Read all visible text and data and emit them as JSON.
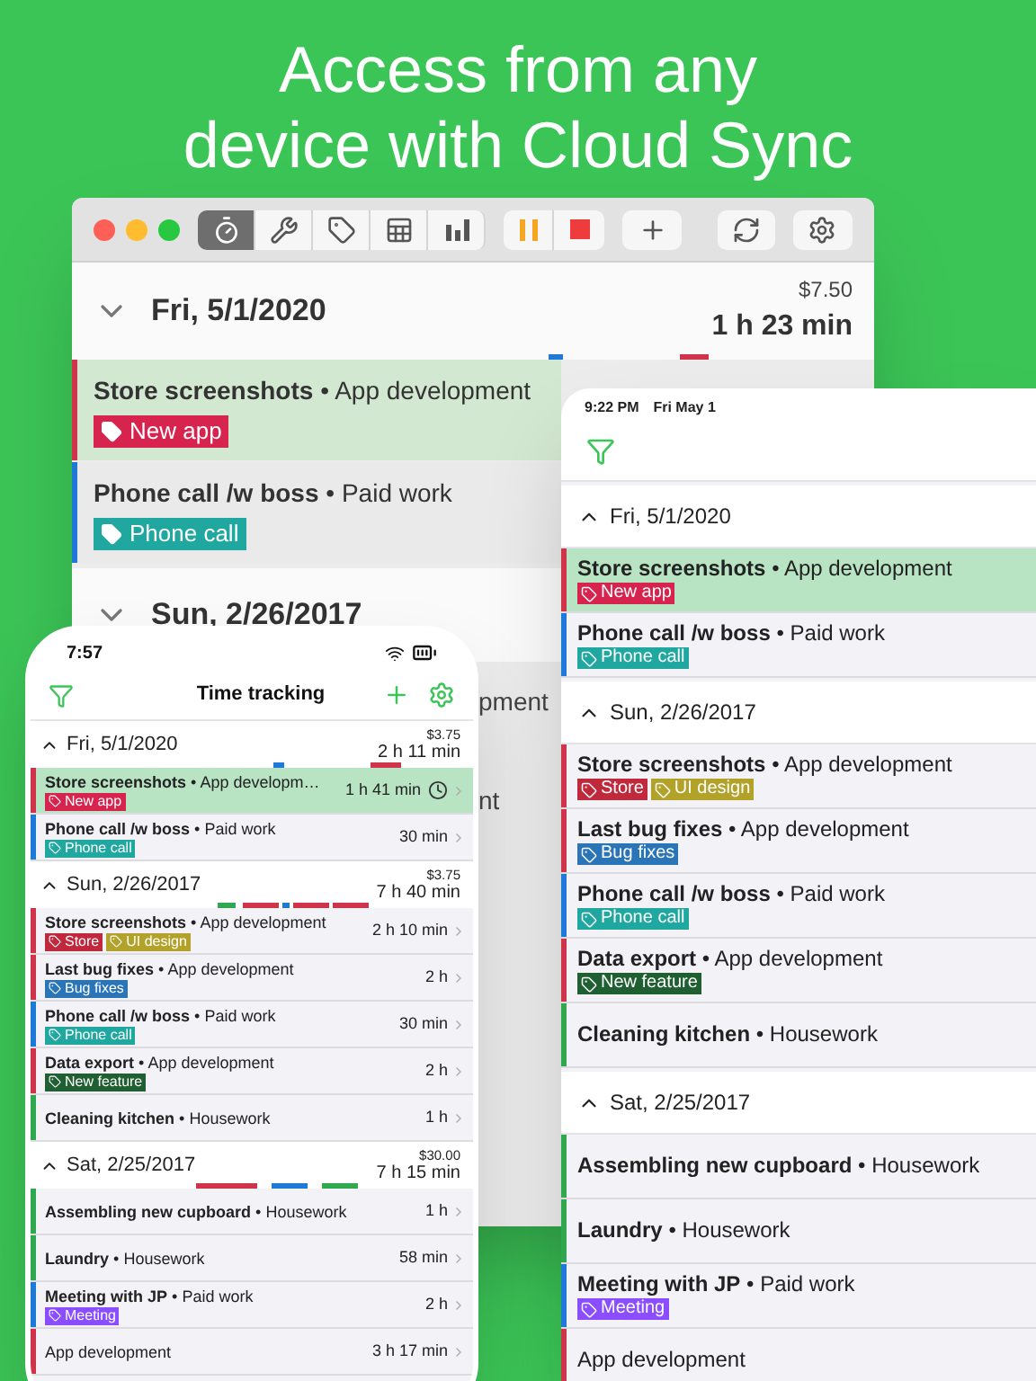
{
  "headline": "Access from any device with Cloud Sync",
  "mac_window": {
    "tools": [
      {
        "selected": true
      },
      {
        "selected": false
      },
      {
        "selected": false
      },
      {
        "selected": false
      },
      {
        "selected": false
      }
    ],
    "days": [
      {
        "date": "Fri, 5/1/2020",
        "amount": "$7.50",
        "total": "1 h 23 min",
        "entries": [
          {
            "title": "Store screenshots",
            "separator": "•",
            "category": "App development",
            "color": "#d0344a",
            "selected": true,
            "tags": [
              {
                "label": "New app",
                "color": "#d6244f"
              }
            ]
          },
          {
            "title": "Phone call /w boss",
            "separator": "•",
            "category": "Paid work",
            "color": "#1e7ad6",
            "selected": false,
            "tags": [
              {
                "label": "Phone call",
                "color": "#20a8a0"
              }
            ]
          }
        ]
      },
      {
        "date": "Sun, 2/26/2017",
        "fragments": [
          "pment",
          "nt"
        ]
      }
    ]
  },
  "ipad": {
    "status": "9:22 PM",
    "status_date": "Fri May 1",
    "days": [
      {
        "date": "Fri, 5/1/2020",
        "entries": [
          {
            "title": "Store screenshots",
            "separator": "•",
            "category": "App development",
            "color": "#d0344a",
            "selected": true,
            "tags": [
              {
                "label": "New app",
                "color": "#d6244f"
              }
            ]
          },
          {
            "title": "Phone call /w boss",
            "separator": "•",
            "category": "Paid work",
            "color": "#1e7ad6",
            "selected": false,
            "tags": [
              {
                "label": "Phone call",
                "color": "#20a8a0"
              }
            ]
          }
        ]
      },
      {
        "date": "Sun, 2/26/2017",
        "entries": [
          {
            "title": "Store screenshots",
            "separator": "•",
            "category": "App development",
            "color": "#d0344a",
            "selected": false,
            "tags": [
              {
                "label": "Store",
                "color": "#c0283c"
              },
              {
                "label": "UI design",
                "color": "#b3a22a"
              }
            ]
          },
          {
            "title": "Last bug fixes",
            "separator": "•",
            "category": "App development",
            "color": "#d0344a",
            "selected": false,
            "tags": [
              {
                "label": "Bug fixes",
                "color": "#2a74b8"
              }
            ]
          },
          {
            "title": "Phone call /w boss",
            "separator": "•",
            "category": "Paid work",
            "color": "#1e7ad6",
            "selected": false,
            "tags": [
              {
                "label": "Phone call",
                "color": "#20a8a0"
              }
            ]
          },
          {
            "title": "Data export",
            "separator": "•",
            "category": "App development",
            "color": "#d0344a",
            "selected": false,
            "tags": [
              {
                "label": "New feature",
                "color": "#1f5f32"
              }
            ]
          },
          {
            "title": "Cleaning kitchen",
            "separator": "•",
            "category": "Housework",
            "color": "#2fa84f",
            "selected": false
          }
        ]
      },
      {
        "date": "Sat, 2/25/2017",
        "entries": [
          {
            "title": "Assembling new cupboard",
            "separator": "•",
            "category": "Housework",
            "color": "#2fa84f",
            "selected": false
          },
          {
            "title": "Laundry",
            "separator": "•",
            "category": "Housework",
            "color": "#2fa84f",
            "selected": false
          },
          {
            "title": "Meeting with JP",
            "separator": "•",
            "category": "Paid work",
            "color": "#1e7ad6",
            "selected": false,
            "tags": [
              {
                "label": "Meeting",
                "color": "#8a4dff"
              }
            ]
          },
          {
            "category": "App development",
            "color": "#d0344a",
            "selected": false
          }
        ]
      }
    ]
  },
  "iphone": {
    "time": "7:57",
    "title": "Time tracking",
    "days": [
      {
        "date": "Fri, 5/1/2020",
        "amount": "$3.75",
        "total": "2 h 11 min",
        "entries": [
          {
            "title": "Store screenshots",
            "separator": "•",
            "category": "App developm…",
            "duration": "1 h 41 min",
            "running": true,
            "color": "#d0344a",
            "selected": true,
            "tags": [
              {
                "label": "New app",
                "color": "#d6244f"
              }
            ]
          },
          {
            "title": "Phone call /w boss",
            "separator": "•",
            "category": "Paid work",
            "duration": "30 min",
            "running": false,
            "color": "#1e7ad6",
            "selected": false,
            "tags": [
              {
                "label": "Phone call",
                "color": "#20a8a0"
              }
            ]
          }
        ]
      },
      {
        "date": "Sun, 2/26/2017",
        "amount": "$3.75",
        "total": "7 h 40 min",
        "entries": [
          {
            "title": "Store screenshots",
            "separator": "•",
            "category": "App development",
            "duration": "2 h 10 min",
            "running": false,
            "color": "#d0344a",
            "selected": false,
            "tags": [
              {
                "label": "Store",
                "color": "#c0283c"
              },
              {
                "label": "UI design",
                "color": "#b3a22a"
              }
            ]
          },
          {
            "title": "Last bug fixes",
            "separator": "•",
            "category": "App development",
            "duration": "2 h",
            "running": false,
            "color": "#d0344a",
            "selected": false,
            "tags": [
              {
                "label": "Bug fixes",
                "color": "#2a74b8"
              }
            ]
          },
          {
            "title": "Phone call /w boss",
            "separator": "•",
            "category": "Paid work",
            "duration": "30 min",
            "running": false,
            "color": "#1e7ad6",
            "selected": false,
            "tags": [
              {
                "label": "Phone call",
                "color": "#20a8a0"
              }
            ]
          },
          {
            "title": "Data export",
            "separator": "•",
            "category": "App development",
            "duration": "2 h",
            "running": false,
            "color": "#d0344a",
            "selected": false,
            "tags": [
              {
                "label": "New feature",
                "color": "#1f5f32"
              }
            ]
          },
          {
            "title": "Cleaning kitchen",
            "separator": "•",
            "category": "Housework",
            "duration": "1 h",
            "running": false,
            "color": "#2fa84f",
            "selected": false
          }
        ]
      },
      {
        "date": "Sat, 2/25/2017",
        "amount": "$30.00",
        "total": "7 h 15 min",
        "entries": [
          {
            "title": "Assembling new cupboard",
            "separator": "•",
            "category": "Housework",
            "duration": "1 h",
            "running": false,
            "color": "#2fa84f",
            "selected": false
          },
          {
            "title": "Laundry",
            "separator": "•",
            "category": "Housework",
            "duration": "58 min",
            "running": false,
            "color": "#2fa84f",
            "selected": false
          },
          {
            "title": "Meeting with JP",
            "separator": "•",
            "category": "Paid work",
            "duration": "2 h",
            "running": false,
            "color": "#1e7ad6",
            "selected": false,
            "tags": [
              {
                "label": "Meeting",
                "color": "#8a4dff"
              }
            ]
          },
          {
            "category": "App development",
            "duration": "3 h 17 min",
            "running": false,
            "color": "#d0344a",
            "selected": false
          }
        ]
      }
    ]
  }
}
